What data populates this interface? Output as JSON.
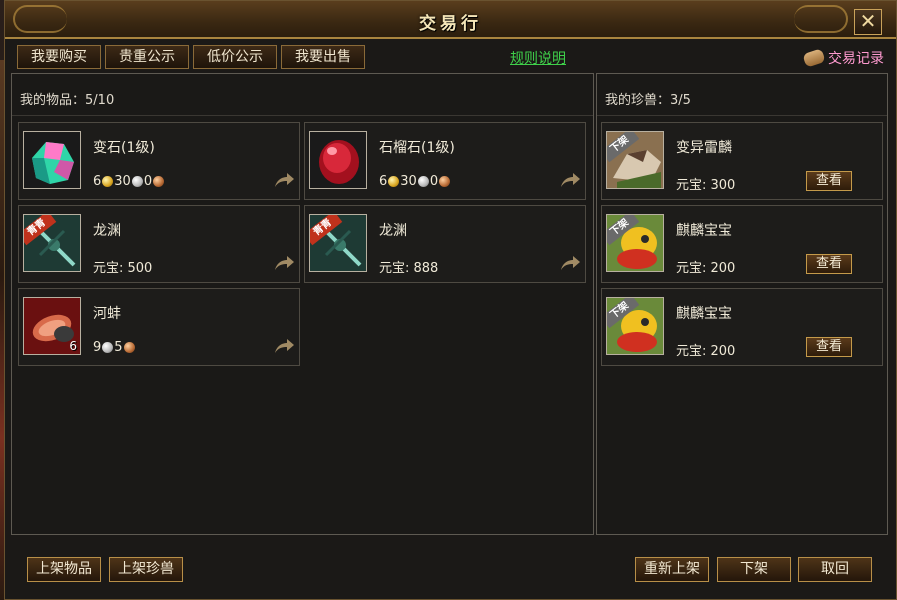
{
  "window": {
    "title": "交易行",
    "close_label": "✕"
  },
  "tabs": [
    {
      "label": "我要购买"
    },
    {
      "label": "贵重公示"
    },
    {
      "label": "低价公示"
    },
    {
      "label": "我要出售"
    }
  ],
  "rules_link": "规则说明",
  "trade_log": {
    "label": "交易记录",
    "icon": "scroll-icon"
  },
  "left_panel": {
    "label": "我的物品",
    "count": "5/10",
    "items": [
      {
        "name": "变石(1级)",
        "price": {
          "gold": "6",
          "silver": "30",
          "copper": "0"
        },
        "icon": "gem-icon"
      },
      {
        "name": "石榴石(1级)",
        "price": {
          "gold": "6",
          "silver": "30",
          "copper": "0"
        },
        "icon": "ruby-icon"
      },
      {
        "name": "龙渊",
        "price_text": "元宝: 500",
        "badge": "青青",
        "icon": "sword-icon"
      },
      {
        "name": "龙渊",
        "price_text": "元宝: 888",
        "badge": "青青",
        "icon": "sword-icon"
      },
      {
        "name": "河蚌",
        "price": {
          "silver": "9",
          "copper": "5"
        },
        "count": "6",
        "icon": "clam-icon"
      }
    ]
  },
  "right_panel": {
    "label": "我的珍兽",
    "count": "3/5",
    "pets": [
      {
        "name": "变异雷麟",
        "price_text": "元宝: 300",
        "badge": "下架",
        "view_label": "查看"
      },
      {
        "name": "麒麟宝宝",
        "price_text": "元宝: 200",
        "badge": "下架",
        "view_label": "查看"
      },
      {
        "name": "麒麟宝宝",
        "price_text": "元宝: 200",
        "badge": "下架",
        "view_label": "查看"
      }
    ]
  },
  "bottom": {
    "list_item": "上架物品",
    "list_pet": "上架珍兽",
    "relist": "重新上架",
    "delist": "下架",
    "cancel": "取回"
  },
  "colors": {
    "accent_gold": "#c49a4a",
    "link_green": "#3fd04a",
    "trade_log_pink": "#ff9ad0"
  }
}
